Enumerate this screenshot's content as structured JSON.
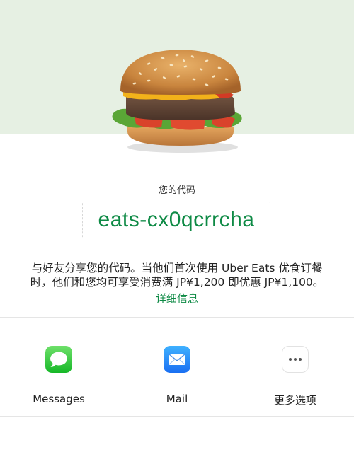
{
  "referral": {
    "label": "您的代码",
    "code": "eats-cx0qcrrcha",
    "description_lines": [
      "与好友分享您的代码。当他们首次使用 Uber Eats 优食订餐",
      "时，他们和您均可享受消费满 JP¥1,200 即优惠 JP¥1,100。"
    ],
    "details_link": "详细信息"
  },
  "share": {
    "options": [
      {
        "label": "Messages",
        "icon": "messages-icon"
      },
      {
        "label": "Mail",
        "icon": "mail-icon"
      },
      {
        "label": "更多选项",
        "icon": "more-icon"
      }
    ]
  },
  "colors": {
    "accent": "#0e8a45",
    "hero_background": "#e6f0e3"
  }
}
